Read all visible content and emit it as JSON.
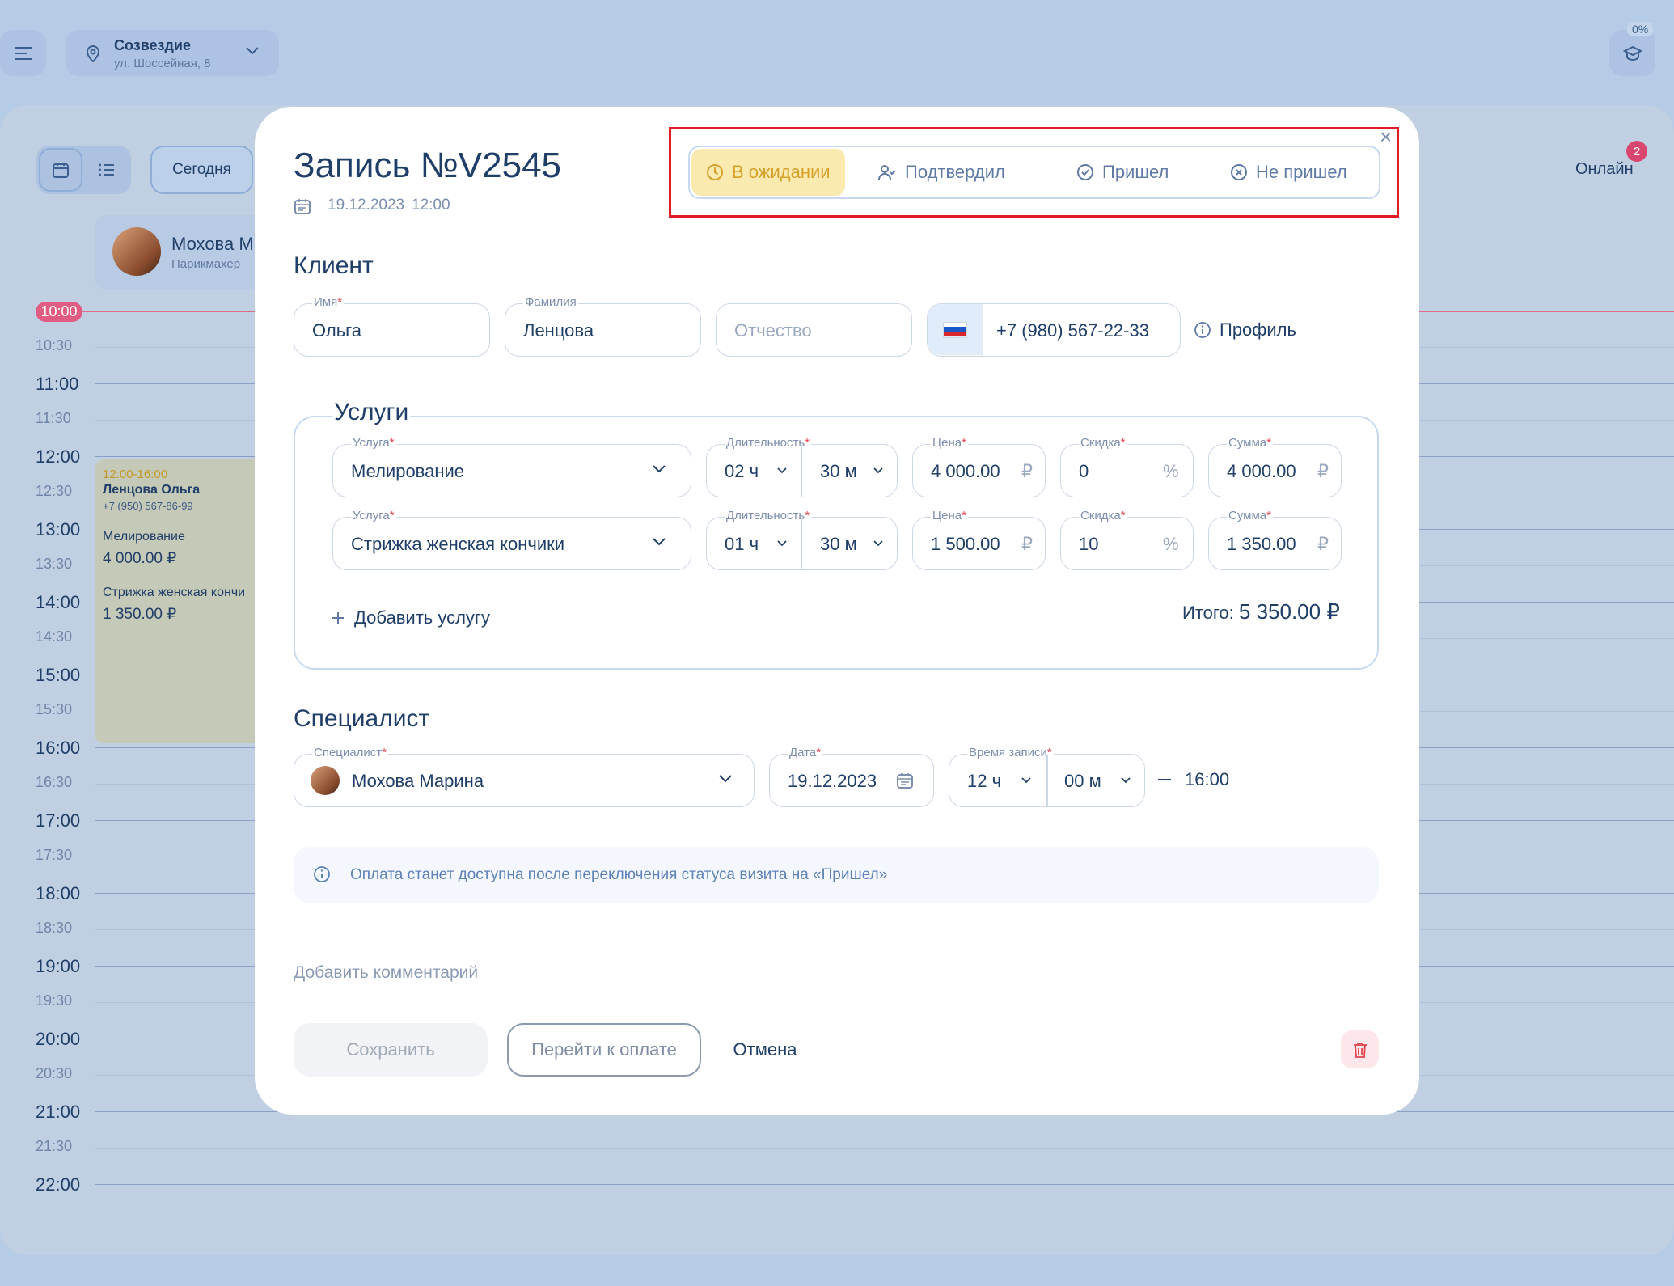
{
  "header": {
    "location_title": "Созвездие",
    "location_address": "ул. Шоссейная, 8",
    "progress_percent": "0%"
  },
  "calendar": {
    "today_label": "Сегодня",
    "online_label": "Онлайн",
    "online_badge": "2",
    "staff": {
      "name": "Мохова М",
      "role": "Парикмахер"
    },
    "now_label": "10:00",
    "times": [
      "10:30",
      "11:00",
      "11:30",
      "12:00",
      "12:30",
      "13:00",
      "13:30",
      "14:00",
      "14:30",
      "15:00",
      "15:30",
      "16:00",
      "16:30",
      "17:00",
      "17:30",
      "18:00",
      "18:30",
      "19:00",
      "19:30",
      "20:00",
      "20:30",
      "21:00",
      "21:30",
      "22:00"
    ],
    "event": {
      "time": "12:00-16:00",
      "client": "Ленцова Ольга",
      "phone": "+7 (950) 567-86-99",
      "service1": "Мелирование",
      "price1": "4 000.00 ₽",
      "service2": "Стрижка женская кончи",
      "price2": "1 350.00 ₽"
    }
  },
  "modal": {
    "title": "Запись №V2545",
    "date": "19.12.2023",
    "time": "12:00",
    "close": "×",
    "statuses": [
      {
        "label": "В ожидании",
        "active": true
      },
      {
        "label": "Подтвердил",
        "active": false
      },
      {
        "label": "Пришел",
        "active": false
      },
      {
        "label": "Не пришел",
        "active": false
      }
    ],
    "client": {
      "section_title": "Клиент",
      "first_name_label": "Имя",
      "first_name": "Ольга",
      "last_name_label": "Фамилия",
      "last_name": "Ленцова",
      "middle_name_placeholder": "Отчество",
      "phone": "+7 (980) 567-22-33",
      "profile_label": "Профиль"
    },
    "services": {
      "section_title": "Услуги",
      "labels": {
        "service": "Услуга",
        "duration": "Длительность",
        "price": "Цена",
        "discount": "Скидка",
        "sum": "Сумма"
      },
      "rows": [
        {
          "service": "Мелирование",
          "hours": "02 ч",
          "minutes": "30 м",
          "price": "4 000.00",
          "discount": "0",
          "sum": "4 000.00"
        },
        {
          "service": "Стрижка женская кончики",
          "hours": "01 ч",
          "minutes": "30 м",
          "price": "1 500.00",
          "discount": "10",
          "sum": "1 350.00"
        }
      ],
      "currency": "₽",
      "percent": "%",
      "add_label": "Добавить услугу",
      "total_label": "Итого:",
      "total_value": "5 350.00 ₽"
    },
    "specialist": {
      "section_title": "Специалист",
      "specialist_label": "Специалист",
      "specialist_name": "Мохова Марина",
      "date_label": "Дата",
      "date": "19.12.2023",
      "time_label": "Время записи",
      "hours": "12 ч",
      "minutes": "00 м",
      "end_time": "16:00"
    },
    "info_text": "Оплата станет доступна после переключения статуса визита на «Пришел»",
    "add_comment": "Добавить комментарий",
    "buttons": {
      "save": "Сохранить",
      "pay": "Перейти к оплате",
      "cancel": "Отмена"
    }
  },
  "colors": {
    "primary_text": "#1f3e68",
    "status_active_bg": "#fbeab0",
    "status_active_text": "#d5a12a",
    "highlight_border": "#e01b24",
    "required_mark": "#e2434d"
  }
}
